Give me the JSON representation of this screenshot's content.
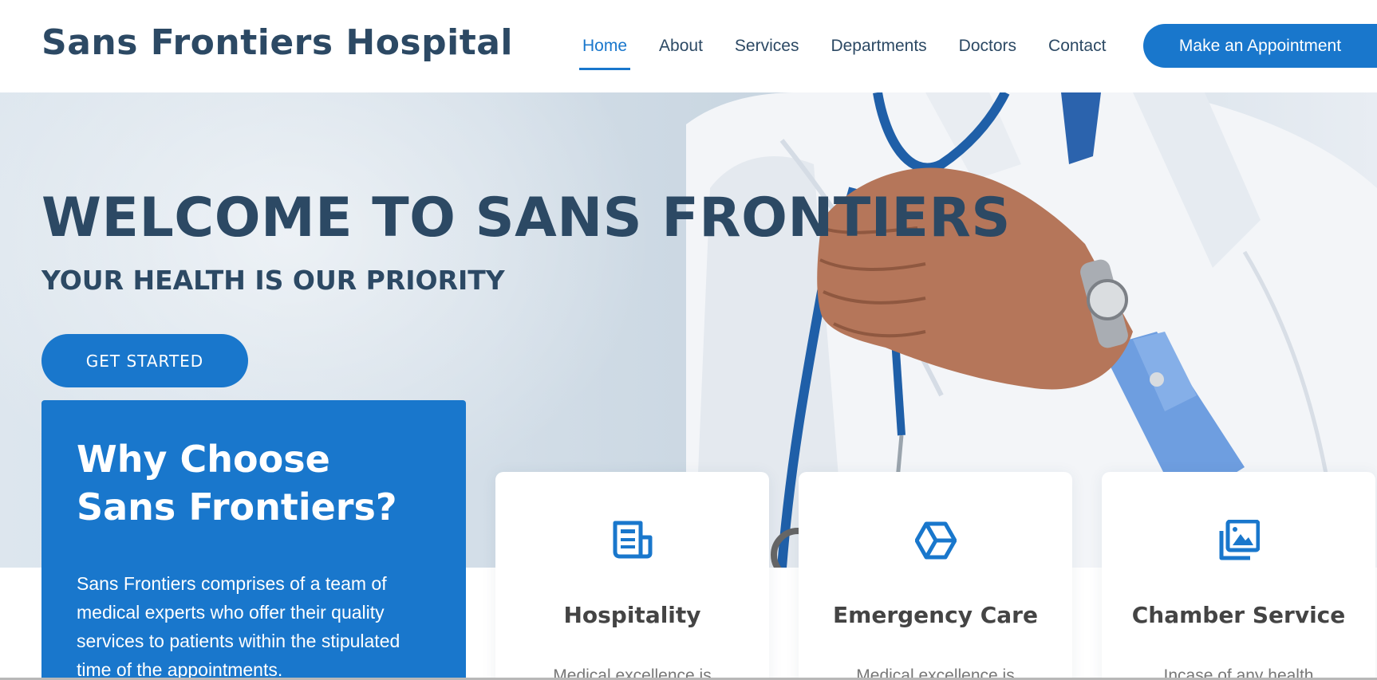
{
  "header": {
    "logo": "Sans Frontiers Hospital",
    "nav": [
      {
        "label": "Home",
        "active": true
      },
      {
        "label": "About",
        "active": false
      },
      {
        "label": "Services",
        "active": false
      },
      {
        "label": "Departments",
        "active": false
      },
      {
        "label": "Doctors",
        "active": false
      },
      {
        "label": "Contact",
        "active": false
      }
    ],
    "appointment_button": "Make an Appointment"
  },
  "hero": {
    "title": "WELCOME TO SANS FRONTIERS",
    "subtitle": "YOUR HEALTH IS OUR PRIORITY",
    "cta": "GET STARTED"
  },
  "why": {
    "title": "Why Choose Sans Frontiers?",
    "text": "Sans Frontiers comprises of a team of medical experts who offer their quality services to patients within the stipulated time of the appointments."
  },
  "cards": [
    {
      "icon": "newspaper-icon",
      "title": "Hospitality",
      "text": "Medical excellence is"
    },
    {
      "icon": "cube-icon",
      "title": "Emergency Care",
      "text": "Medical excellence is"
    },
    {
      "icon": "images-icon",
      "title": "Chamber Service",
      "text": "Incase of any health"
    }
  ],
  "colors": {
    "accent": "#1977cc",
    "heading": "#2c4964",
    "card_title": "#444444",
    "muted_text": "#777777"
  }
}
